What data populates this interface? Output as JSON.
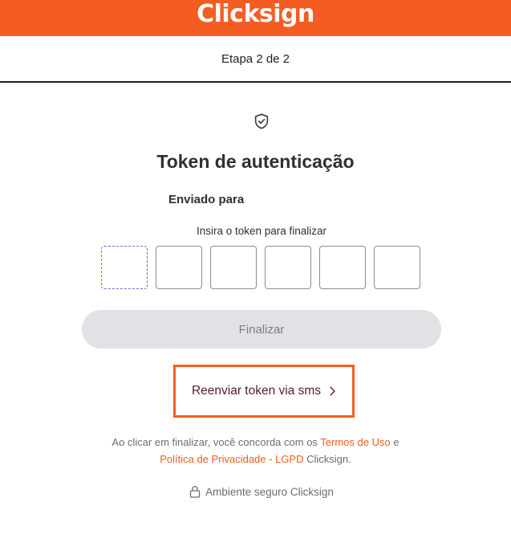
{
  "header": {
    "brand": "Clicksign",
    "brand_color": "#f45d22"
  },
  "step": {
    "label": "Etapa 2 de 2"
  },
  "main": {
    "icon": "shield-check-icon",
    "title": "Token de autenticação",
    "sent_to_label": "Enviado para",
    "instruction": "Insira o token para finalizar",
    "token_digits": [
      "",
      "",
      "",
      "",
      "",
      ""
    ],
    "finalize_label": "Finalizar",
    "resend_label": "Reenviar token via sms",
    "resend_icon": "chevron-right-icon"
  },
  "legal": {
    "prefix": "Ao clicar em finalizar, você concorda com os ",
    "terms_link": "Termos de Uso",
    "and": " e",
    "privacy_link": "Política de Privacidade - LGPD",
    "suffix": " Clicksign."
  },
  "footer": {
    "icon": "lock-icon",
    "secure_label": "Ambiente seguro Clicksign"
  }
}
